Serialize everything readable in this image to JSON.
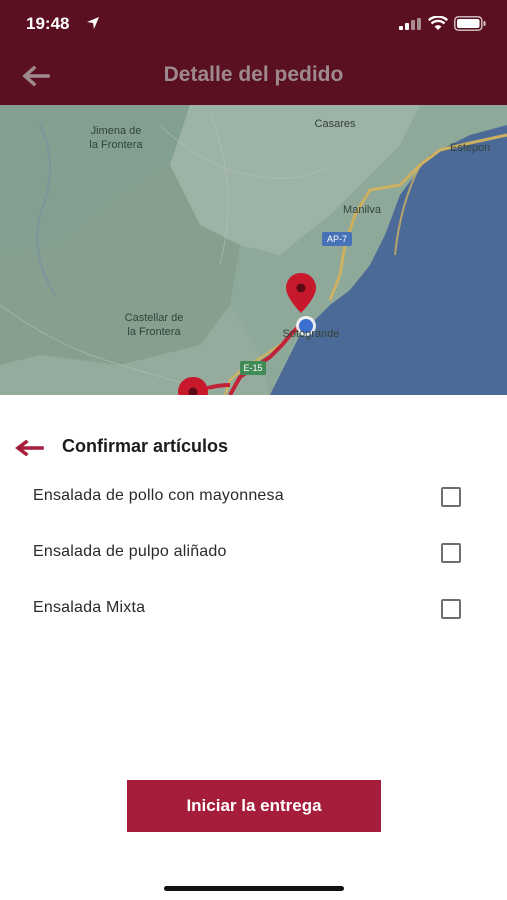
{
  "status_bar": {
    "time": "19:48"
  },
  "header": {
    "title": "Detalle del pedido"
  },
  "map": {
    "labels": {
      "jimena": "Jimena de\nla Frontera",
      "casares": "Casares",
      "estepona": "Estepon",
      "manilva": "Manilva",
      "castellar": "Castellar de\nla Frontera",
      "sotogrande": "Sotogrande",
      "ap7": "AP-7",
      "e15": "E-15"
    }
  },
  "section": {
    "title": "Confirmar artículos"
  },
  "items": [
    {
      "label": "Ensalada de pollo con mayonnesa",
      "checked": false
    },
    {
      "label": "Ensalada de pulpo aliñado",
      "checked": false
    },
    {
      "label": "Ensalada Mixta",
      "checked": false
    }
  ],
  "actions": {
    "start_delivery": "Iniciar la entrega"
  },
  "colors": {
    "header": "#5a1020",
    "accent": "#a51d3a",
    "sea": "#4c6a98",
    "land": "#8ea89a"
  }
}
